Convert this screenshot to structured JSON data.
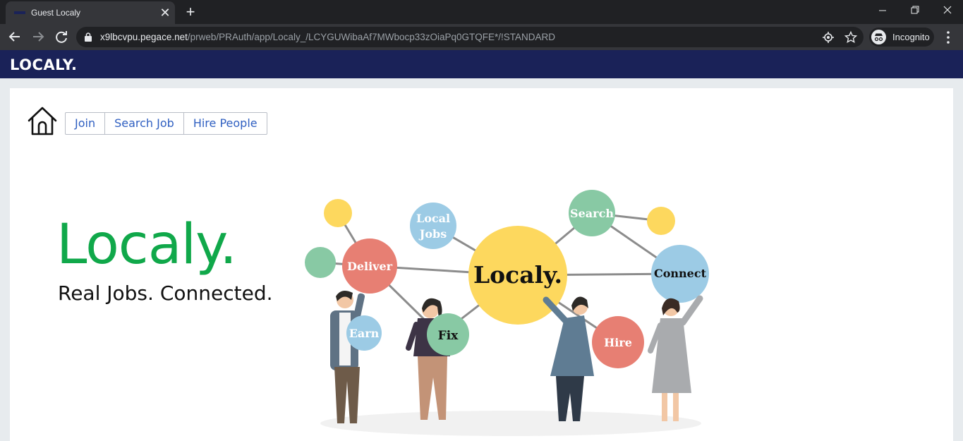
{
  "browser": {
    "tab_title": "Guest Localy",
    "new_tab_label": "+",
    "url_host": "x9lbcvpu.pegace.net",
    "url_path": "/prweb/PRAuth/app/Localy_/LCYGUWibaAf7MWbocp33zOiaPq0GTQFE*/!STANDARD",
    "incognito_label": "Incognito"
  },
  "app": {
    "brand": "LOCALY.",
    "nav": [
      "Join",
      "Search Job",
      "Hire People"
    ],
    "hero_title": "Localy.",
    "hero_tagline": "Real Jobs. Connected."
  },
  "illustration": {
    "center_label": "Localy.",
    "bubbles": [
      "Local",
      "Jobs",
      "Search",
      "Deliver",
      "Connect",
      "Earn",
      "Fix",
      "Hire"
    ]
  },
  "colors": {
    "appbar": "#1a2258",
    "brand_green": "#10a84a",
    "link_blue": "#2f5fc1",
    "bubble_yellow": "#fdd85e",
    "bubble_red": "#e77f73",
    "bubble_blue": "#9ccbe5",
    "bubble_green": "#88c9a4"
  }
}
